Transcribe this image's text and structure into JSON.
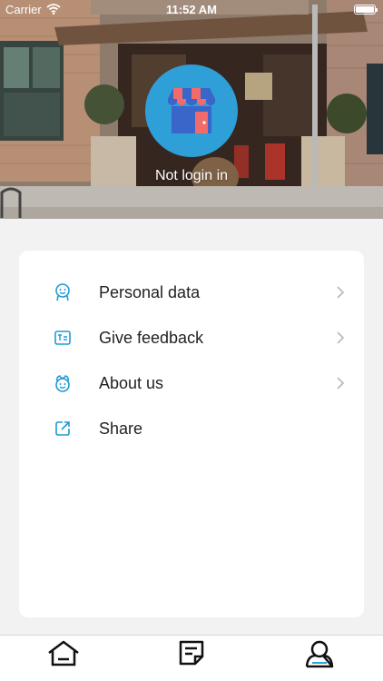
{
  "status_bar": {
    "carrier": "Carrier",
    "time": "11:52 AM",
    "wifi_icon": "wifi-icon",
    "battery_level": 1.0
  },
  "header": {
    "avatar_icon": "store-icon",
    "login_status": "Not login in"
  },
  "menu": {
    "items": [
      {
        "label": "Personal data",
        "icon": "person-icon",
        "has_chevron": true
      },
      {
        "label": "Give feedback",
        "icon": "feedback-icon",
        "has_chevron": true
      },
      {
        "label": "About us",
        "icon": "smiley-icon",
        "has_chevron": true
      },
      {
        "label": "Share",
        "icon": "share-icon",
        "has_chevron": false
      }
    ]
  },
  "tab_bar": {
    "tabs": [
      {
        "icon": "home-icon"
      },
      {
        "icon": "notes-icon"
      },
      {
        "icon": "profile-icon",
        "selected": true
      }
    ]
  },
  "colors": {
    "accent": "#2f9fd8",
    "icon_blue": "#1e9bd7",
    "store_red": "#f26b6b",
    "store_blue": "#3a65c9",
    "chevron": "#b8b8b8",
    "background": "#f2f2f2"
  }
}
